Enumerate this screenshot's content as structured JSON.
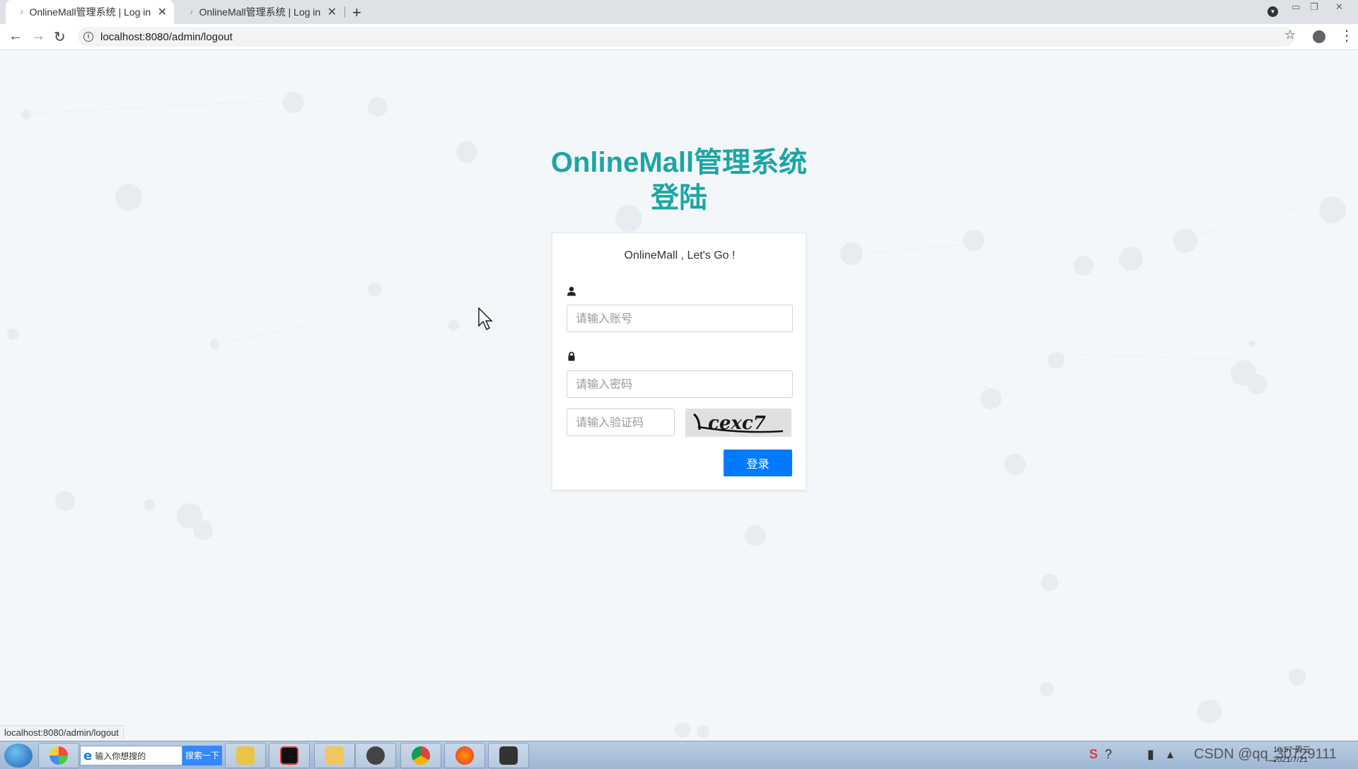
{
  "browser": {
    "tabs": [
      {
        "title": "OnlineMall管理系统 | Log in",
        "active": true
      },
      {
        "title": "OnlineMall管理系统 | Log in",
        "active": false
      }
    ],
    "url": "localhost:8080/admin/logout",
    "status_url": "localhost:8080/admin/logout"
  },
  "login": {
    "title_line1": "OnlineMall管理系统",
    "title_line2": "登陆",
    "subtitle": "OnlineMall , Let's Go !",
    "username_placeholder": "请输入账号",
    "password_placeholder": "请输入密码",
    "captcha_placeholder": "请输入验证码",
    "captcha_text": "cexc7",
    "login_button": "登录",
    "title_color": "#1ba6a6",
    "button_color": "#007bff"
  },
  "taskbar": {
    "search_placeholder": "输入你想搜的",
    "search_button": "搜索一下",
    "tray_watermark": "CSDN @qq_30729111",
    "time": "10:57 周三",
    "date": "2021/7/21"
  }
}
